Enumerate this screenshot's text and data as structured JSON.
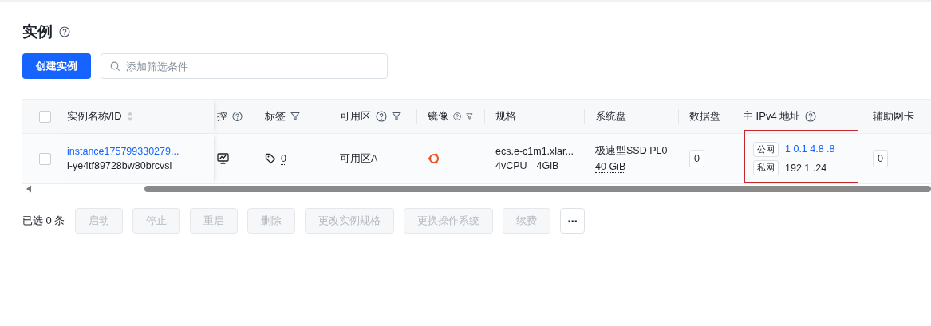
{
  "page": {
    "title": "实例"
  },
  "toolbar": {
    "create_button": "创建实例",
    "search": {
      "placeholder": "添加筛选条件"
    }
  },
  "table": {
    "select_all": {
      "checked": false
    },
    "columns": [
      {
        "label": "实例名称/ID",
        "kind": "sort"
      },
      {
        "label": "控",
        "kind": "help"
      },
      {
        "label": "标签",
        "kind": "filter"
      },
      {
        "label": "可用区",
        "kind": "help-filter"
      },
      {
        "label": "镜像",
        "kind": "help-filter"
      },
      {
        "label": "规格",
        "kind": "plain"
      },
      {
        "label": "系统盘",
        "kind": "plain"
      },
      {
        "label": "数据盘",
        "kind": "plain"
      },
      {
        "label": "主 IPv4 地址",
        "kind": "help"
      },
      {
        "label": "辅助网卡",
        "kind": "plain"
      }
    ],
    "rows": [
      {
        "checked": false,
        "name": "instance175799330279...",
        "id": "i-ye4tf89728bw80brcvsi",
        "tag_count": "0",
        "zone": "可用区A",
        "spec": "ecs.e-c1m1.xlar...",
        "cpu": "4vCPU",
        "memory": "4GiB",
        "system_disk_type": "极速型SSD PL0",
        "system_disk_size": "40 GiB",
        "data_disk_count": "0",
        "public_label": "公网",
        "public_ip": "1 0.1 4.8 .8",
        "private_label": "私网",
        "private_ip": "192.1 .24",
        "ip_highlighted": true,
        "eni_count": "0"
      }
    ]
  },
  "batch": {
    "selected_text": "已选 0 条",
    "buttons": [
      {
        "label": "启动",
        "disabled": true
      },
      {
        "label": "停止",
        "disabled": true
      },
      {
        "label": "重启",
        "disabled": true
      },
      {
        "label": "删除",
        "disabled": true
      },
      {
        "label": "更改实例规格",
        "disabled": true
      },
      {
        "label": "更换操作系统",
        "disabled": true
      },
      {
        "label": "续费",
        "disabled": true
      }
    ],
    "more": "⋯"
  }
}
